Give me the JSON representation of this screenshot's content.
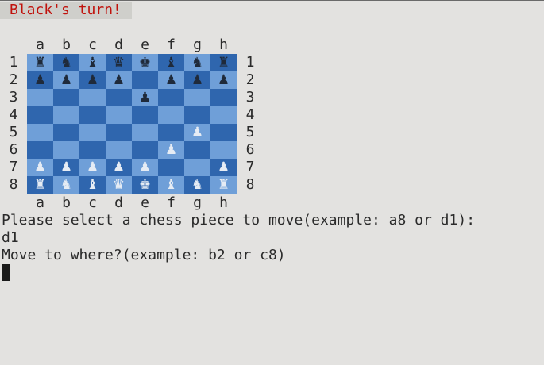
{
  "status": {
    "turn": "Black's turn!"
  },
  "board": {
    "files": [
      "a",
      "b",
      "c",
      "d",
      "e",
      "f",
      "g",
      "h"
    ],
    "ranks": [
      "1",
      "2",
      "3",
      "4",
      "5",
      "6",
      "7",
      "8"
    ],
    "colors": {
      "light": "#6f9fd8",
      "dark": "#2f66ae",
      "black_piece": "#1f2a3a",
      "white_piece": "#e6ecf4"
    },
    "rows": [
      [
        {
          "c": "b",
          "p": "♜",
          "name": "black-rook"
        },
        {
          "c": "b",
          "p": "♞",
          "name": "black-knight"
        },
        {
          "c": "b",
          "p": "♝",
          "name": "black-bishop"
        },
        {
          "c": "b",
          "p": "♛",
          "name": "black-queen"
        },
        {
          "c": "b",
          "p": "♚",
          "name": "black-king"
        },
        {
          "c": "b",
          "p": "♝",
          "name": "black-bishop"
        },
        {
          "c": "b",
          "p": "♞",
          "name": "black-knight"
        },
        {
          "c": "b",
          "p": "♜",
          "name": "black-rook"
        }
      ],
      [
        {
          "c": "b",
          "p": "♟",
          "name": "black-pawn"
        },
        {
          "c": "b",
          "p": "♟",
          "name": "black-pawn"
        },
        {
          "c": "b",
          "p": "♟",
          "name": "black-pawn"
        },
        {
          "c": "b",
          "p": "♟",
          "name": "black-pawn"
        },
        null,
        {
          "c": "b",
          "p": "♟",
          "name": "black-pawn"
        },
        {
          "c": "b",
          "p": "♟",
          "name": "black-pawn"
        },
        {
          "c": "b",
          "p": "♟",
          "name": "black-pawn"
        }
      ],
      [
        null,
        null,
        null,
        null,
        {
          "c": "b",
          "p": "♟",
          "name": "black-pawn"
        },
        null,
        null,
        null
      ],
      [
        null,
        null,
        null,
        null,
        null,
        null,
        null,
        null
      ],
      [
        null,
        null,
        null,
        null,
        null,
        null,
        {
          "c": "w",
          "p": "♟",
          "name": "white-pawn"
        },
        null
      ],
      [
        null,
        null,
        null,
        null,
        null,
        {
          "c": "w",
          "p": "♟",
          "name": "white-pawn"
        },
        null,
        null
      ],
      [
        {
          "c": "w",
          "p": "♟",
          "name": "white-pawn"
        },
        {
          "c": "w",
          "p": "♟",
          "name": "white-pawn"
        },
        {
          "c": "w",
          "p": "♟",
          "name": "white-pawn"
        },
        {
          "c": "w",
          "p": "♟",
          "name": "white-pawn"
        },
        {
          "c": "w",
          "p": "♟",
          "name": "white-pawn"
        },
        null,
        null,
        {
          "c": "w",
          "p": "♟",
          "name": "white-pawn"
        }
      ],
      [
        {
          "c": "w",
          "p": "♜",
          "name": "white-rook"
        },
        {
          "c": "w",
          "p": "♞",
          "name": "white-knight"
        },
        {
          "c": "w",
          "p": "♝",
          "name": "white-bishop"
        },
        {
          "c": "w",
          "p": "♛",
          "name": "white-queen"
        },
        {
          "c": "w",
          "p": "♚",
          "name": "white-king"
        },
        {
          "c": "w",
          "p": "♝",
          "name": "white-bishop"
        },
        {
          "c": "w",
          "p": "♞",
          "name": "white-knight"
        },
        {
          "c": "w",
          "p": "♜",
          "name": "white-rook"
        }
      ]
    ]
  },
  "console": {
    "prompt_select": "Please select a chess piece to move(example: a8 or d1):",
    "input_select": "d1",
    "prompt_move": "Move to where?(example: b2 or c8)"
  }
}
